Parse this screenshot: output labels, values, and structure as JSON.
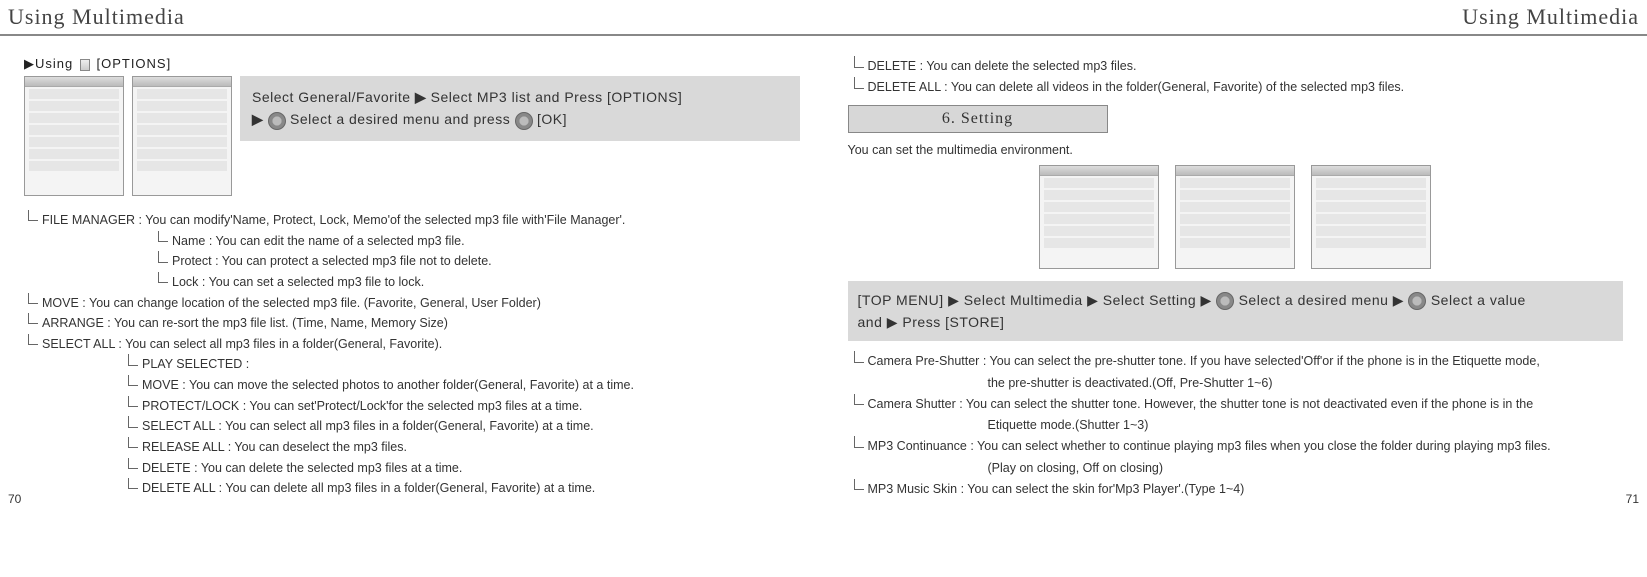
{
  "header": {
    "left": "Using Multimedia",
    "right": "Using Multimedia"
  },
  "left": {
    "using_label_prefix": "▶Using",
    "using_label_suffix": "[OPTIONS]",
    "instr_line1_a": "Select General/Favorite",
    "instr_line1_b": "Select MP3 list and Press",
    "instr_line1_c": "[OPTIONS]",
    "instr_line2_a": "Select a desired menu and press",
    "instr_line2_b": "[OK]",
    "fm": "FILE MANAGER : You can modify'Name, Protect, Lock, Memo'of the selected mp3 file with'File Manager'.",
    "fm_name": "Name : You can edit the name of a selected mp3 file.",
    "fm_protect": "Protect : You can protect a selected mp3 file not to delete.",
    "fm_lock": "Lock : You can set a selected mp3 file to lock.",
    "move": "MOVE : You can change location of the selected mp3 file. (Favorite, General, User Folder)",
    "arrange": "ARRANGE : You can re-sort the mp3 file list. (Time, Name, Memory Size)",
    "select_all": "SELECT ALL : You can select all mp3 files in a folder(General, Favorite).",
    "sa_play": "PLAY SELECTED :",
    "sa_move": "MOVE : You can move the selected photos to another folder(General, Favorite) at a time.",
    "sa_protect": "PROTECT/LOCK : You can set'Protect/Lock'for the selected mp3 files at a time.",
    "sa_selectall": "SELECT ALL : You can select all mp3 files in a folder(General, Favorite) at a time.",
    "sa_release": "RELEASE ALL : You can deselect the mp3 files.",
    "sa_delete": "DELETE : You can delete the selected mp3 files at a time.",
    "sa_deleteall": "DELETE ALL : You can delete all mp3 files in a folder(General, Favorite) at a time.",
    "page": "70"
  },
  "right": {
    "top_delete": "DELETE : You can delete the selected mp3 files.",
    "top_delete_all": "DELETE ALL : You can delete all videos in the folder(General, Favorite) of the selected mp3 files.",
    "setting_title": "6. Setting",
    "setting_desc": "You can set the multimedia environment.",
    "bar_topmenu": "[TOP MENU]",
    "bar_a": "Select Multimedia",
    "bar_b": "Select Setting",
    "bar_c": "Select a desired menu",
    "bar_d": "Select a value",
    "bar_and": "and",
    "bar_press": "Press",
    "bar_store": "[STORE]",
    "cam_pre_1": "Camera Pre-Shutter : You can select the pre-shutter tone. If you have selected'Off'or if the phone is in the Etiquette mode,",
    "cam_pre_2": "the pre-shutter is deactivated.(Off, Pre-Shutter 1~6)",
    "cam_sh_1": "Camera Shutter : You can select the shutter tone. However, the shutter tone is not deactivated even if the phone is in the",
    "cam_sh_2": "Etiquette mode.(Shutter 1~3)",
    "mp3_cont_1": "MP3 Continuance : You can select whether to continue playing mp3 files when you close the folder during playing mp3 files.",
    "mp3_cont_2": "(Play on closing, Off on closing)",
    "mp3_skin": "MP3 Music Skin : You can select the skin for'Mp3 Player'.(Type 1~4)",
    "page": "71"
  }
}
